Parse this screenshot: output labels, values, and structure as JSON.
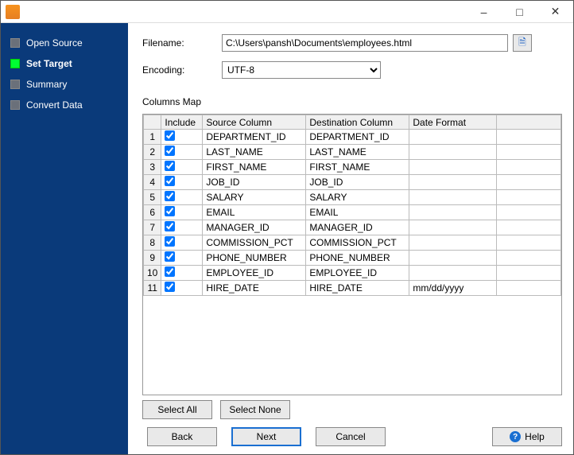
{
  "sidebar": {
    "items": [
      {
        "label": "Open Source",
        "active": false
      },
      {
        "label": "Set Target",
        "active": true
      },
      {
        "label": "Summary",
        "active": false
      },
      {
        "label": "Convert Data",
        "active": false
      }
    ]
  },
  "form": {
    "filename_label": "Filename:",
    "filename_value": "C:\\Users\\pansh\\Documents\\employees.html",
    "encoding_label": "Encoding:",
    "encoding_value": "UTF-8"
  },
  "columns_map": {
    "title": "Columns Map",
    "headers": {
      "include": "Include",
      "source": "Source Column",
      "destination": "Destination Column",
      "date_format": "Date Format"
    },
    "rows": [
      {
        "n": "1",
        "include": true,
        "source": "DEPARTMENT_ID",
        "destination": "DEPARTMENT_ID",
        "date_format": ""
      },
      {
        "n": "2",
        "include": true,
        "source": "LAST_NAME",
        "destination": "LAST_NAME",
        "date_format": ""
      },
      {
        "n": "3",
        "include": true,
        "source": "FIRST_NAME",
        "destination": "FIRST_NAME",
        "date_format": ""
      },
      {
        "n": "4",
        "include": true,
        "source": "JOB_ID",
        "destination": "JOB_ID",
        "date_format": ""
      },
      {
        "n": "5",
        "include": true,
        "source": "SALARY",
        "destination": "SALARY",
        "date_format": ""
      },
      {
        "n": "6",
        "include": true,
        "source": "EMAIL",
        "destination": "EMAIL",
        "date_format": ""
      },
      {
        "n": "7",
        "include": true,
        "source": "MANAGER_ID",
        "destination": "MANAGER_ID",
        "date_format": ""
      },
      {
        "n": "8",
        "include": true,
        "source": "COMMISSION_PCT",
        "destination": "COMMISSION_PCT",
        "date_format": ""
      },
      {
        "n": "9",
        "include": true,
        "source": "PHONE_NUMBER",
        "destination": "PHONE_NUMBER",
        "date_format": ""
      },
      {
        "n": "10",
        "include": true,
        "source": "EMPLOYEE_ID",
        "destination": "EMPLOYEE_ID",
        "date_format": ""
      },
      {
        "n": "11",
        "include": true,
        "source": "HIRE_DATE",
        "destination": "HIRE_DATE",
        "date_format": "mm/dd/yyyy"
      }
    ]
  },
  "buttons": {
    "select_all": "Select All",
    "select_none": "Select None",
    "back": "Back",
    "next": "Next",
    "cancel": "Cancel",
    "help": "Help"
  }
}
